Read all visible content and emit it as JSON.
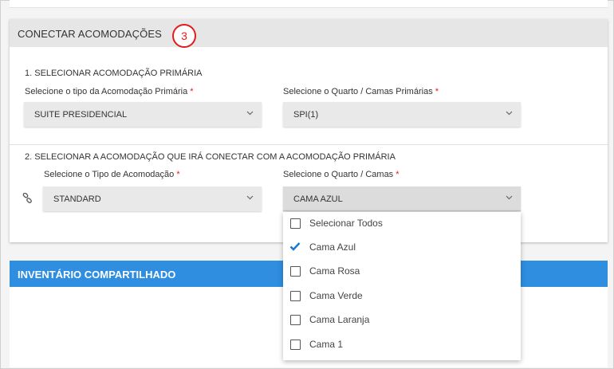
{
  "colors": {
    "accent_blue": "#2f8ee0",
    "required_red": "#e31b1b",
    "check_blue": "#1976d2"
  },
  "connect": {
    "title": "CONECTAR ACOMODAÇÕES",
    "step_number": "3",
    "section1_label": "1. SELECIONAR ACOMODAÇÃO PRIMÁRIA",
    "primary_type_label": "Selecione o tipo da Acomodação Primária",
    "primary_type_value": "SUITE PRESIDENCIAL",
    "primary_room_label": "Selecione o Quarto / Camas Primárias",
    "primary_room_value": "SPI(1)",
    "required_mark": "*",
    "section2_label": "2. SELECIONAR A ACOMODAÇÃO QUE IRÁ CONECTAR COM A ACOMODAÇÃO PRIMÁRIA",
    "accom_type_label": "Selecione o Tipo de Acomodação",
    "accom_type_value": "STANDARD",
    "room_beds_label": "Selecione o Quarto / Camas",
    "room_beds_value": "CAMA AZUL",
    "link_icon": "link-icon"
  },
  "dropdown": {
    "items": [
      {
        "label": "Selecionar Todos",
        "checked": false
      },
      {
        "label": "Cama Azul",
        "checked": true
      },
      {
        "label": "Cama Rosa",
        "checked": false
      },
      {
        "label": "Cama Verde",
        "checked": false
      },
      {
        "label": "Cama Laranja",
        "checked": false
      },
      {
        "label": "Cama 1",
        "checked": false
      }
    ]
  },
  "shared_inventory": {
    "title": "INVENTÁRIO COMPARTILHADO"
  }
}
